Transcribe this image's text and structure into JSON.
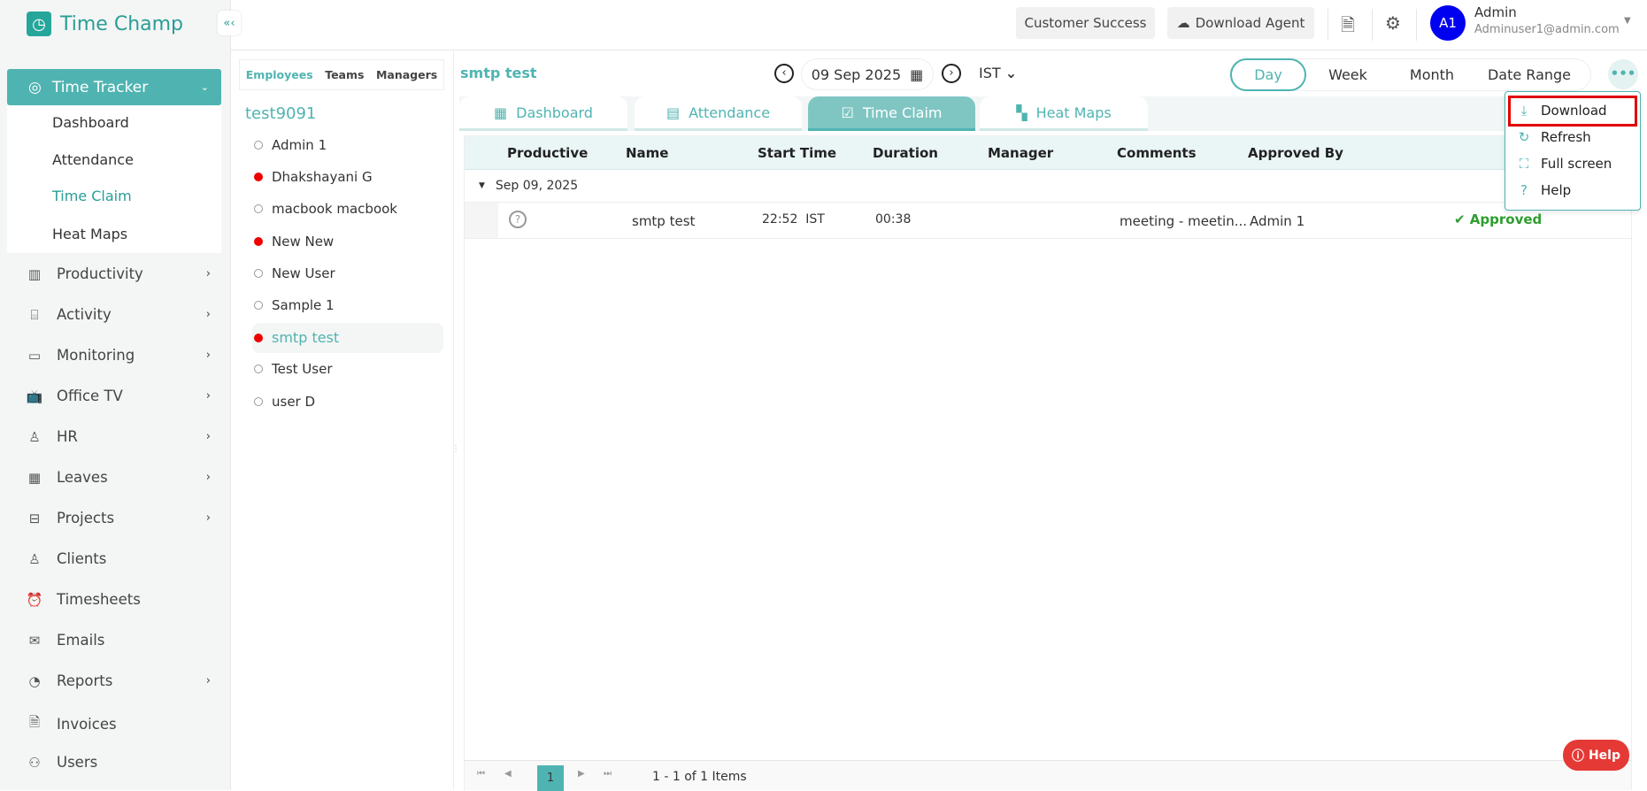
{
  "app": {
    "name": "Time Champ"
  },
  "sidebar": {
    "active": "Time Tracker",
    "sub_items": [
      "Dashboard",
      "Attendance",
      "Time Claim",
      "Heat Maps"
    ],
    "items": [
      {
        "label": "Productivity",
        "icon": "bar-chart-icon",
        "chev": true
      },
      {
        "label": "Activity",
        "icon": "ticket-icon",
        "chev": true
      },
      {
        "label": "Monitoring",
        "icon": "monitor-icon",
        "chev": true
      },
      {
        "label": "Office TV",
        "icon": "tv-icon",
        "chev": true
      },
      {
        "label": "HR",
        "icon": "person-icon",
        "chev": true
      },
      {
        "label": "Leaves",
        "icon": "calendar-icon",
        "chev": true
      },
      {
        "label": "Projects",
        "icon": "briefcase-icon",
        "chev": true
      },
      {
        "label": "Clients",
        "icon": "client-icon",
        "chev": false
      },
      {
        "label": "Timesheets",
        "icon": "alarm-clock-icon",
        "chev": false
      },
      {
        "label": "Emails",
        "icon": "mail-icon",
        "chev": false
      },
      {
        "label": "Reports",
        "icon": "pie-chart-icon",
        "chev": true
      },
      {
        "label": "Invoices",
        "icon": "invoice-icon",
        "chev": false
      },
      {
        "label": "Users",
        "icon": "users-icon",
        "chev": false
      }
    ]
  },
  "header": {
    "customer_success": "Customer Success",
    "download_agent": "Download Agent",
    "avatar": "A1",
    "user_name": "Admin",
    "user_email": "Adminuser1@admin.com"
  },
  "employees": {
    "tabs": [
      "Employees",
      "Teams",
      "Managers"
    ],
    "team": "test9091",
    "list": [
      {
        "name": "Admin 1",
        "online": false
      },
      {
        "name": "Dhakshayani G",
        "online": true
      },
      {
        "name": "macbook macbook",
        "online": false
      },
      {
        "name": "New New",
        "online": true
      },
      {
        "name": "New User",
        "online": false
      },
      {
        "name": "Sample 1",
        "online": false
      },
      {
        "name": "smtp test",
        "online": true,
        "selected": true
      },
      {
        "name": "Test User",
        "online": false
      },
      {
        "name": "user D",
        "online": false
      }
    ]
  },
  "main": {
    "selected_user": "smtp test",
    "date": "09 Sep 2025",
    "timezone": "IST",
    "ranges": [
      "Day",
      "Week",
      "Month",
      "Date Range"
    ],
    "tabs": [
      "Dashboard",
      "Attendance",
      "Time Claim",
      "Heat Maps"
    ],
    "menu": [
      "Download",
      "Refresh",
      "Full screen",
      "Help"
    ]
  },
  "table": {
    "columns": [
      "Productive",
      "Name",
      "Start Time",
      "Duration",
      "Manager",
      "Comments",
      "Approved By"
    ],
    "group": "Sep 09, 2025",
    "rows": [
      {
        "name": "smtp test",
        "start": "22:52  IST",
        "duration": "00:38",
        "manager": "",
        "comments": "meeting - meetin...",
        "approved_by": "Admin 1",
        "status": "Approved"
      }
    ]
  },
  "pagination": {
    "page": "1",
    "summary": "1 - 1 of 1 Items"
  },
  "help_button": "Help",
  "colors": {
    "accent": "#4fb4b1",
    "status_ok": "#2e9e2e",
    "highlight": "#e00000"
  }
}
